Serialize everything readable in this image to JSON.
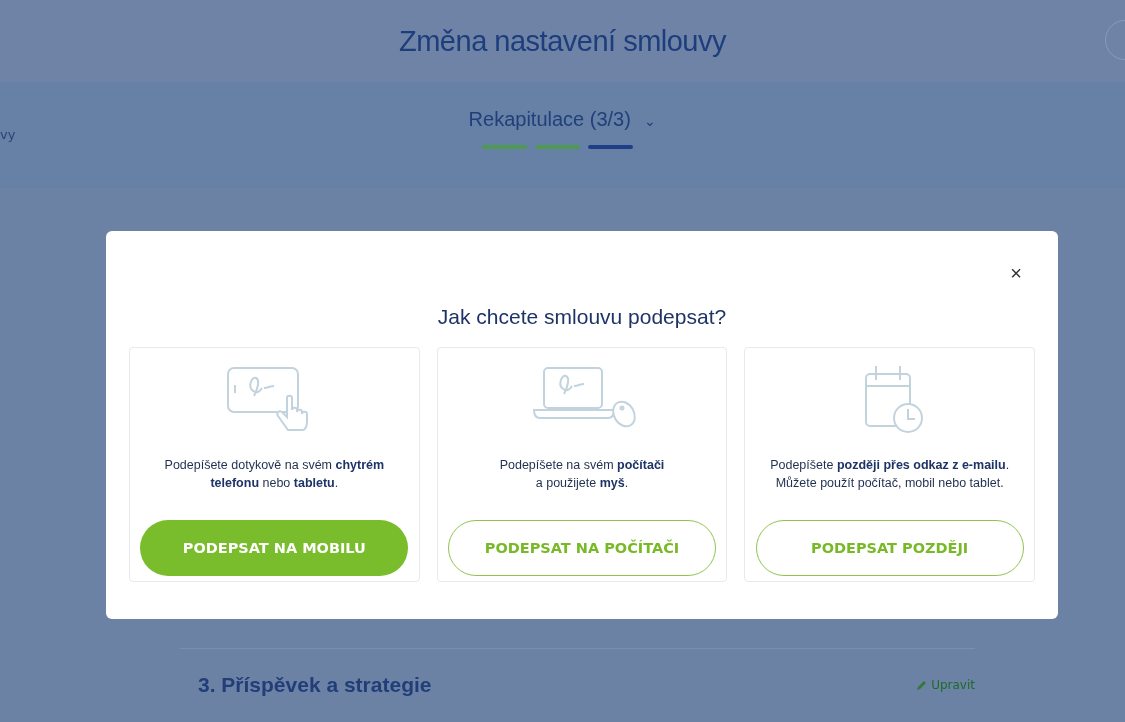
{
  "header": {
    "title": "Změna nastavení smlouvy"
  },
  "step_bar": {
    "previous_step_cut": "vy",
    "current_step": "Rekapitulace (3/3)",
    "caret": "⌄",
    "steps": [
      {
        "selected": false
      },
      {
        "selected": false
      },
      {
        "selected": true
      }
    ]
  },
  "sections": [
    {
      "heading": "3. Příspěvek a strategie",
      "edit_link": "Upravit"
    }
  ],
  "dialog": {
    "close": "×",
    "title": "Jak chcete smlouvu podepsat?",
    "options": [
      {
        "text": "Podepíšete dotykově na svém **chytrém telefonu** nebo **tabletu**.",
        "button": "PODEPSAT NA MOBILU",
        "kind": "primary"
      },
      {
        "text": "Podepíšete na svém **počítači**\na použijete **myš**.",
        "button": "PODEPSAT NA POČÍTAČI",
        "kind": "secondary"
      },
      {
        "text": "Podepíšete **později přes odkaz z e-mailu**.\nMůžete použít počítač, mobil nebo tablet.",
        "button": "PODEPSAT POZDĚJI",
        "kind": "secondary"
      }
    ]
  }
}
